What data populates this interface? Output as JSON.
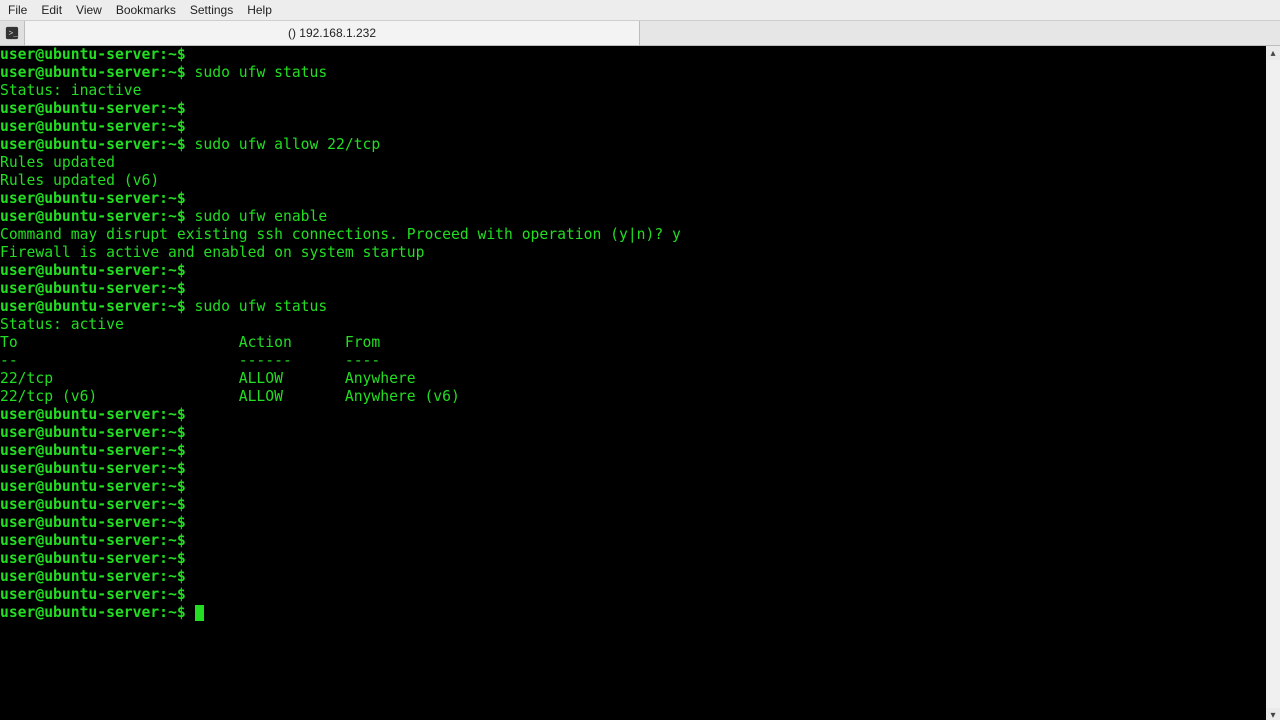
{
  "menubar": {
    "items": [
      "File",
      "Edit",
      "View",
      "Bookmarks",
      "Settings",
      "Help"
    ]
  },
  "tab": {
    "label": "() 192.168.1.232"
  },
  "prompt": {
    "user": "user@ubuntu-server",
    "sep": ":",
    "path": "~",
    "symbol": "$"
  },
  "session": [
    {
      "type": "prompt",
      "cmd": ""
    },
    {
      "type": "prompt",
      "cmd": "sudo ufw status"
    },
    {
      "type": "output",
      "text": "Status: inactive"
    },
    {
      "type": "prompt",
      "cmd": ""
    },
    {
      "type": "prompt",
      "cmd": ""
    },
    {
      "type": "prompt",
      "cmd": "sudo ufw allow 22/tcp"
    },
    {
      "type": "output",
      "text": "Rules updated"
    },
    {
      "type": "output",
      "text": "Rules updated (v6)"
    },
    {
      "type": "prompt",
      "cmd": ""
    },
    {
      "type": "prompt",
      "cmd": "sudo ufw enable"
    },
    {
      "type": "output",
      "text": "Command may disrupt existing ssh connections. Proceed with operation (y|n)? y"
    },
    {
      "type": "output",
      "text": "Firewall is active and enabled on system startup"
    },
    {
      "type": "prompt",
      "cmd": ""
    },
    {
      "type": "prompt",
      "cmd": ""
    },
    {
      "type": "prompt",
      "cmd": "sudo ufw status"
    },
    {
      "type": "output",
      "text": "Status: active"
    },
    {
      "type": "output",
      "text": ""
    },
    {
      "type": "output",
      "text": "To                         Action      From"
    },
    {
      "type": "output",
      "text": "--                         ------      ----"
    },
    {
      "type": "output",
      "text": "22/tcp                     ALLOW       Anywhere"
    },
    {
      "type": "output",
      "text": "22/tcp (v6)                ALLOW       Anywhere (v6)"
    },
    {
      "type": "output",
      "text": ""
    },
    {
      "type": "prompt",
      "cmd": ""
    },
    {
      "type": "prompt",
      "cmd": ""
    },
    {
      "type": "prompt",
      "cmd": ""
    },
    {
      "type": "prompt",
      "cmd": ""
    },
    {
      "type": "prompt",
      "cmd": ""
    },
    {
      "type": "prompt",
      "cmd": ""
    },
    {
      "type": "prompt",
      "cmd": ""
    },
    {
      "type": "prompt",
      "cmd": ""
    },
    {
      "type": "prompt",
      "cmd": ""
    },
    {
      "type": "prompt",
      "cmd": ""
    },
    {
      "type": "prompt",
      "cmd": ""
    },
    {
      "type": "prompt-cursor",
      "cmd": ""
    }
  ]
}
